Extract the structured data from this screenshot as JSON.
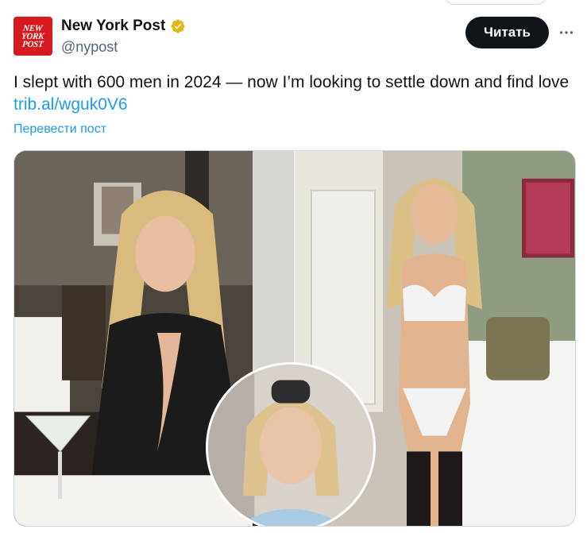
{
  "account": {
    "name": "New York Post",
    "handle": "@nypost",
    "avatar_text": [
      "NEW",
      "YORK",
      "POST"
    ],
    "verified_icon": "verified-badge-gold",
    "brand_color": "#d71920"
  },
  "actions": {
    "follow_label": "Читать",
    "more_icon": "more-horizontal-icon"
  },
  "tweet": {
    "text": "I slept with 600 men in 2024 — now I’m looking to settle down and find love",
    "link": "trib.al/wguk0V6",
    "translate_label": "Перевести пост"
  },
  "media": {
    "images": [
      "photo-restaurant",
      "photo-bedroom",
      "photo-selfie-inset"
    ]
  },
  "colors": {
    "link": "#1d9bf0",
    "text_primary": "#0f1419",
    "text_secondary": "#536471",
    "button_bg": "#0f1419"
  }
}
